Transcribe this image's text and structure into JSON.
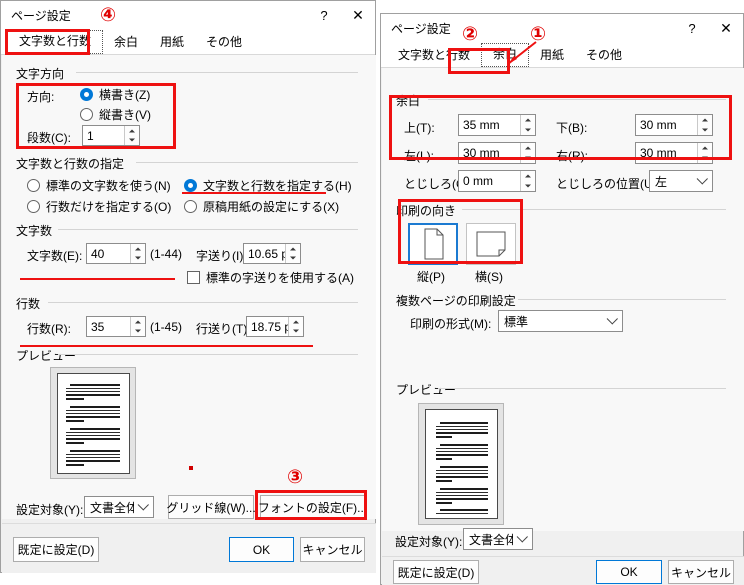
{
  "left_dialog": {
    "title": "ページ設定",
    "titlebar_buttons": [
      {
        "name": "help",
        "glyph": "?"
      },
      {
        "name": "close",
        "glyph": "✕"
      }
    ],
    "tabs": [
      {
        "label": "文字数と行数",
        "active": true
      },
      {
        "label": "余白",
        "active": false
      },
      {
        "label": "用紙",
        "active": false
      },
      {
        "label": "その他",
        "active": false
      }
    ],
    "group_text_direction": {
      "title": "文字方向",
      "direction_label": "方向:",
      "options": [
        {
          "label": "横書き(Z)",
          "selected": true
        },
        {
          "label": "縦書き(V)",
          "selected": false
        }
      ],
      "columns_label": "段数(C):",
      "columns_value": "1"
    },
    "group_spec": {
      "title": "文字数と行数の指定",
      "options": [
        {
          "label": "標準の文字数を使う(N)",
          "selected": false
        },
        {
          "label": "文字数と行数を指定する(H)",
          "selected": true
        },
        {
          "label": "行数だけを指定する(O)",
          "selected": false
        },
        {
          "label": "原稿用紙の設定にする(X)",
          "selected": false
        }
      ]
    },
    "group_chars": {
      "title": "文字数",
      "chars_label": "文字数(E):",
      "chars_value": "40",
      "chars_range": "(1-44)",
      "pitch_label": "字送り(I):",
      "pitch_value": "10.65 p",
      "use_standard_pitch": "標準の字送りを使用する(A)",
      "use_standard_pitch_checked": false
    },
    "group_lines": {
      "title": "行数",
      "lines_label": "行数(R):",
      "lines_value": "35",
      "lines_range": "(1-45)",
      "leading_label": "行送り(T):",
      "leading_value": "18.75 p"
    },
    "group_preview": {
      "title": "プレビュー"
    },
    "apply_to_label": "設定対象(Y):",
    "apply_to_value": "文書全体",
    "grid_button": "グリッド線(W)...",
    "font_button": "フォントの設定(F)...",
    "default_button": "既定に設定(D)",
    "ok_button": "OK",
    "cancel_button": "キャンセル"
  },
  "right_dialog": {
    "title": "ページ設定",
    "titlebar_buttons": [
      {
        "name": "help",
        "glyph": "?"
      },
      {
        "name": "close",
        "glyph": "✕"
      }
    ],
    "tabs": [
      {
        "label": "文字数と行数",
        "active": false
      },
      {
        "label": "余白",
        "active": true
      },
      {
        "label": "用紙",
        "active": false
      },
      {
        "label": "その他",
        "active": false
      }
    ],
    "group_margins": {
      "title": "余白",
      "top_label": "上(T):",
      "top_value": "35 mm",
      "bottom_label": "下(B):",
      "bottom_value": "30 mm",
      "left_label": "左(L):",
      "left_value": "30 mm",
      "right_label": "右(R):",
      "right_value": "30 mm",
      "gutter_label": "とじしろ(G):",
      "gutter_value": "0 mm",
      "gutter_pos_label": "とじしろの位置(U):",
      "gutter_pos_value": "左"
    },
    "group_orientation": {
      "title": "印刷の向き",
      "portrait_label": "縦(P)",
      "landscape_label": "横(S)",
      "selected": "portrait"
    },
    "group_multipage": {
      "title": "複数ページの印刷設定",
      "format_label": "印刷の形式(M):",
      "format_value": "標準"
    },
    "group_preview": {
      "title": "プレビュー"
    },
    "apply_to_label": "設定対象(Y):",
    "apply_to_value": "文書全体",
    "default_button": "既定に設定(D)",
    "ok_button": "OK",
    "cancel_button": "キャンセル"
  },
  "annotations": {
    "markers": [
      {
        "label": "①",
        "target": "右ダイアログ 用紙タブ"
      },
      {
        "label": "②",
        "target": "右ダイアログ 余白タブ"
      },
      {
        "label": "③",
        "target": "左ダイアログ フォントの設定ボタン"
      },
      {
        "label": "④",
        "target": "左ダイアログ 文字数と行数タブ"
      }
    ],
    "accent_color": "#ee1111"
  }
}
